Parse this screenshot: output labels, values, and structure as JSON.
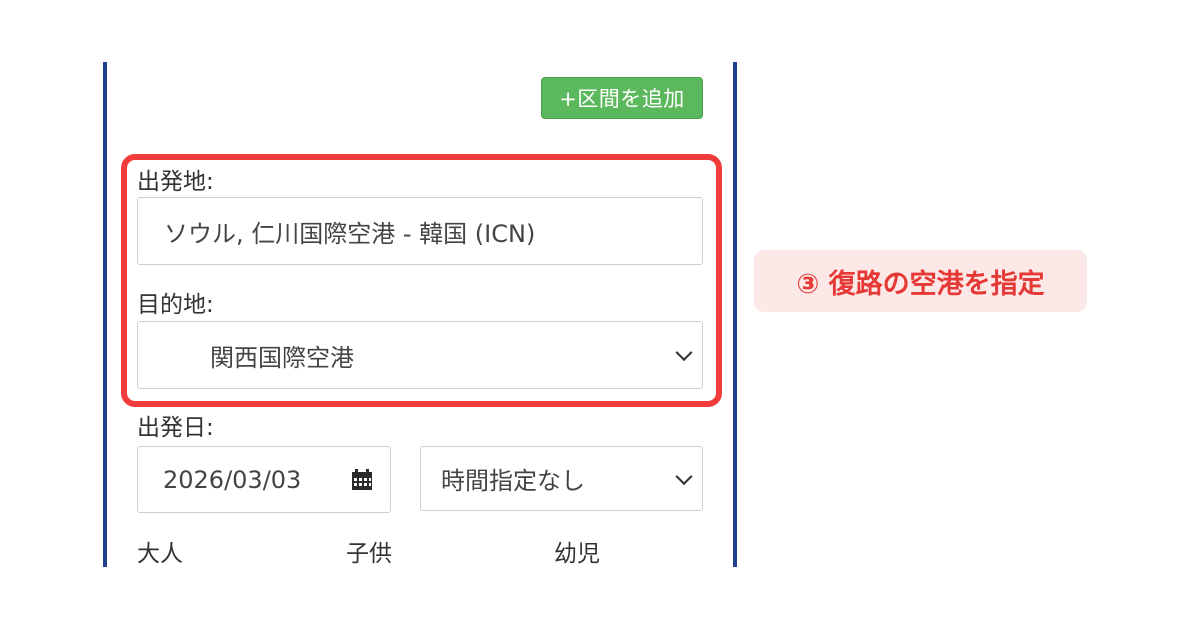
{
  "form": {
    "add_segment_label": "+区間を追加",
    "departure_label": "出発地:",
    "departure_value": "ソウル, 仁川国際空港 - 韓国 (ICN)",
    "destination_label": "目的地:",
    "destination_value": "関西国際空港",
    "date_label": "出発日:",
    "date_value": "2026/03/03",
    "time_value": "時間指定なし",
    "pax": {
      "adult_label": "大人",
      "child_label": "子供",
      "infant_label": "幼児"
    }
  },
  "annotation": {
    "callout_text": "③ 復路の空港を指定"
  },
  "colors": {
    "panel_border": "#1f3f8f",
    "add_button": "#5cb85c",
    "highlight": "#f23b3b",
    "callout_bg": "#fde8e8",
    "callout_text": "#e53935"
  },
  "icons": {
    "calendar": "calendar-icon",
    "select": "chevron-down-icon"
  }
}
